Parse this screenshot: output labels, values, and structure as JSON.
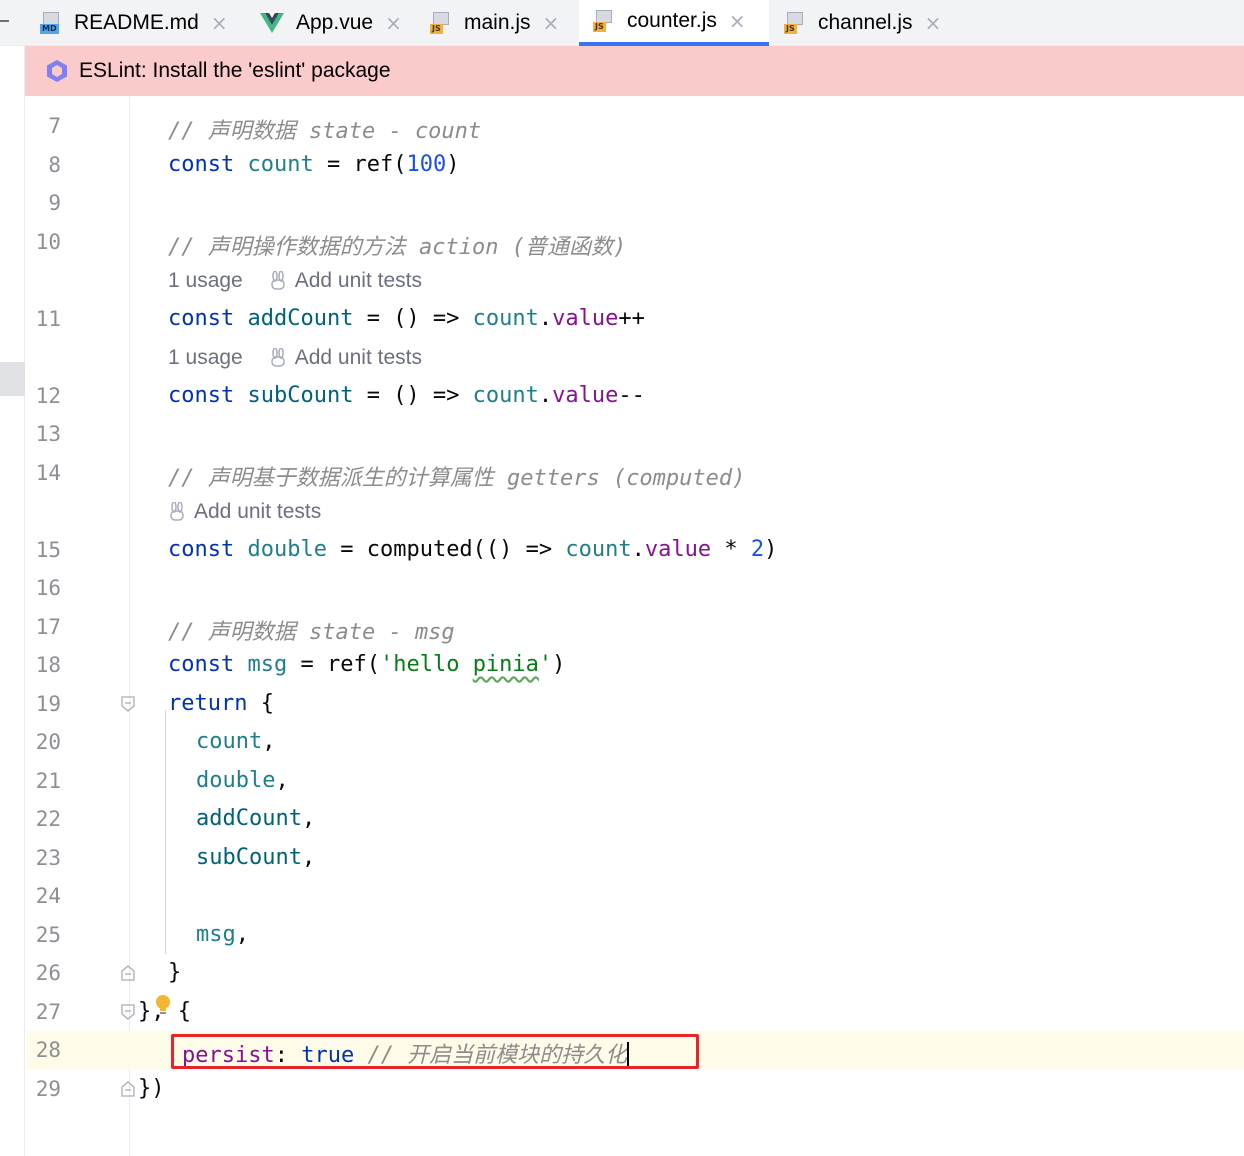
{
  "tabs": [
    {
      "label": "README.md",
      "icon": "markdown-file-icon",
      "badge": "MD",
      "active": false
    },
    {
      "label": "App.vue",
      "icon": "vue-file-icon",
      "active": false
    },
    {
      "label": "main.js",
      "icon": "js-file-icon",
      "badge": "JS",
      "active": false
    },
    {
      "label": "counter.js",
      "icon": "js-file-icon",
      "badge": "JS",
      "active": true
    },
    {
      "label": "channel.js",
      "icon": "js-file-icon",
      "badge": "JS",
      "active": false
    }
  ],
  "close_glyph": "×",
  "banner": {
    "text": "ESLint: Install the 'eslint' package",
    "icon": "eslint-icon"
  },
  "hints": {
    "usage": "1 usage",
    "add_tests": "Add unit tests"
  },
  "lines": {
    "l7": {
      "num": "7",
      "comment": "// 声明数据 state - count"
    },
    "l8": {
      "num": "8",
      "kw": "const",
      "name": "count",
      "eq": " = ",
      "fn": "ref(",
      "val": "100",
      "close": ")"
    },
    "l9": {
      "num": "9"
    },
    "l10": {
      "num": "10",
      "comment": "// 声明操作数据的方法 action (普通函数)"
    },
    "l11": {
      "num": "11",
      "kw": "const",
      "name": "addCount",
      "arrow": " = () => ",
      "obj": "count",
      "dot": ".",
      "prop": "value",
      "op": "++"
    },
    "l12": {
      "num": "12",
      "kw": "const",
      "name": "subCount",
      "arrow": " = () => ",
      "obj": "count",
      "dot": ".",
      "prop": "value",
      "op": "--"
    },
    "l13": {
      "num": "13"
    },
    "l14": {
      "num": "14",
      "comment": "// 声明基于数据派生的计算属性 getters (computed)"
    },
    "l15": {
      "num": "15",
      "kw": "const",
      "name": "double",
      "eq": " = ",
      "fn": "computed(() => ",
      "obj": "count",
      "dot": ".",
      "prop": "value",
      "mul": " * ",
      "val": "2",
      "close": ")"
    },
    "l16": {
      "num": "16"
    },
    "l17": {
      "num": "17",
      "comment": "// 声明数据 state - msg"
    },
    "l18": {
      "num": "18",
      "kw": "const",
      "name": "msg",
      "eq": " = ",
      "fn": "ref(",
      "str_open": "'hello ",
      "str_typo": "pinia",
      "str_close": "'",
      "close": ")"
    },
    "l19": {
      "num": "19",
      "kw": "return",
      "brace": " {"
    },
    "l20": {
      "num": "20",
      "item": "count",
      "comma": ","
    },
    "l21": {
      "num": "21",
      "item": "double",
      "comma": ","
    },
    "l22": {
      "num": "22",
      "item": "addCount",
      "comma": ","
    },
    "l23": {
      "num": "23",
      "item": "subCount",
      "comma": ","
    },
    "l24": {
      "num": "24"
    },
    "l25": {
      "num": "25",
      "item": "msg",
      "comma": ","
    },
    "l26": {
      "num": "26",
      "brace": "}"
    },
    "l27": {
      "num": "27",
      "text": "}, {"
    },
    "l28": {
      "num": "28",
      "key": "persist",
      "colon": ": ",
      "kw": "true",
      "comment": " // 开启当前模块的持久化"
    },
    "l29": {
      "num": "29",
      "text": "})"
    }
  },
  "colors": {
    "keyword": "#0033b3",
    "comment": "#8c8c8c",
    "string": "#067d17",
    "number": "#1750eb",
    "property": "#871094",
    "banner_bg": "#fbcbcb",
    "highlight_box": "#e8242b",
    "active_tab_underline": "#3574f0"
  }
}
